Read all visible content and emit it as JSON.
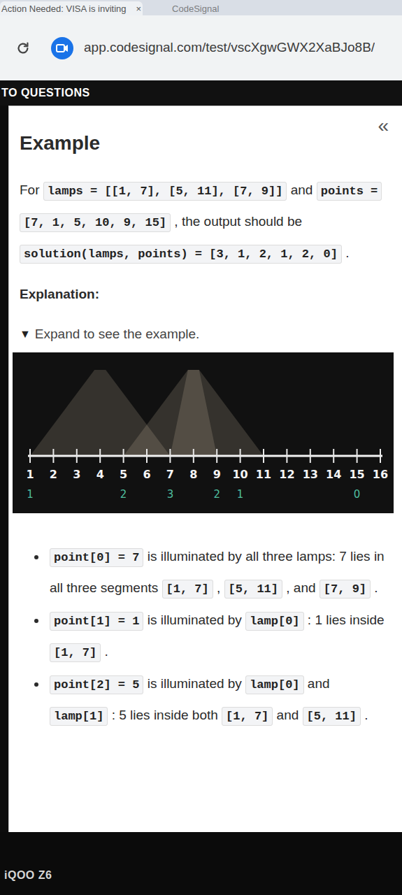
{
  "browser": {
    "tabs": [
      {
        "label": "Action Needed: VISA is inviting",
        "close": "×",
        "selected": true
      },
      {
        "label": "CodeSignal",
        "selected": false
      }
    ],
    "address": "app.codesignal.com/test/vscXgwGWX2XaBJo8B/"
  },
  "header": {
    "back": "TO QUESTIONS",
    "collapse": "«"
  },
  "example": {
    "title": "Example",
    "intro": [
      {
        "text": "For ",
        "kind": "text"
      },
      {
        "text": "lamps = [[1, 7], [5, 11], [7, 9]]",
        "kind": "code"
      },
      {
        "text": " and ",
        "kind": "text"
      },
      {
        "text": "points = [7, 1, 5, 10, 9, 15]",
        "kind": "code"
      },
      {
        "text": " , the output should be ",
        "kind": "text"
      },
      {
        "text": "solution(lamps, points) = [3, 1, 2, 1, 2, 0]",
        "kind": "code"
      },
      {
        "text": " .",
        "kind": "text"
      }
    ],
    "explanation_title": "Explanation:",
    "expander": {
      "arrow": "▼",
      "label": "Expand to see the example.",
      "expanded": true
    },
    "chart": {
      "lamps": [
        {
          "start": 1,
          "end": 7
        },
        {
          "start": 5,
          "end": 11
        },
        {
          "start": 7,
          "end": 9
        }
      ],
      "ticks": [
        "1",
        "2",
        "3",
        "4",
        "5",
        "6",
        "7",
        "8",
        "9",
        "10",
        "11",
        "12",
        "13",
        "14",
        "15",
        "16"
      ],
      "points": [
        {
          "x": 1,
          "count": "1"
        },
        {
          "x": 5,
          "count": "2"
        },
        {
          "x": 7,
          "count": "3"
        },
        {
          "x": 9,
          "count": "2"
        },
        {
          "x": 10,
          "count": "1"
        },
        {
          "x": 15,
          "count": "0"
        }
      ]
    },
    "bullets": [
      [
        {
          "text": "point[0] = 7",
          "kind": "code"
        },
        {
          "text": " is illuminated by all three lamps: 7 lies in all three segments ",
          "kind": "text"
        },
        {
          "text": "[1, 7]",
          "kind": "code"
        },
        {
          "text": " , ",
          "kind": "text"
        },
        {
          "text": "[5, 11]",
          "kind": "code"
        },
        {
          "text": " , and ",
          "kind": "text"
        },
        {
          "text": "[7, 9]",
          "kind": "code"
        },
        {
          "text": " .",
          "kind": "text"
        }
      ],
      [
        {
          "text": "point[1] = 1",
          "kind": "code"
        },
        {
          "text": " is illuminated by ",
          "kind": "text"
        },
        {
          "text": "lamp[0]",
          "kind": "code"
        },
        {
          "text": " : 1 lies inside ",
          "kind": "text"
        },
        {
          "text": "[1, 7]",
          "kind": "code"
        },
        {
          "text": " .",
          "kind": "text"
        }
      ],
      [
        {
          "text": "point[2] = 5",
          "kind": "code"
        },
        {
          "text": " is illuminated by ",
          "kind": "text"
        },
        {
          "text": "lamp[0]",
          "kind": "code"
        },
        {
          "text": " and ",
          "kind": "text"
        },
        {
          "text": "lamp[1]",
          "kind": "code"
        },
        {
          "text": " : 5 lies inside both ",
          "kind": "text"
        },
        {
          "text": "[1, 7]",
          "kind": "code"
        },
        {
          "text": " and ",
          "kind": "text"
        },
        {
          "text": "[5, 11]",
          "kind": "code"
        },
        {
          "text": " .",
          "kind": "text"
        }
      ]
    ]
  },
  "watermark": "iQOO Z6"
}
